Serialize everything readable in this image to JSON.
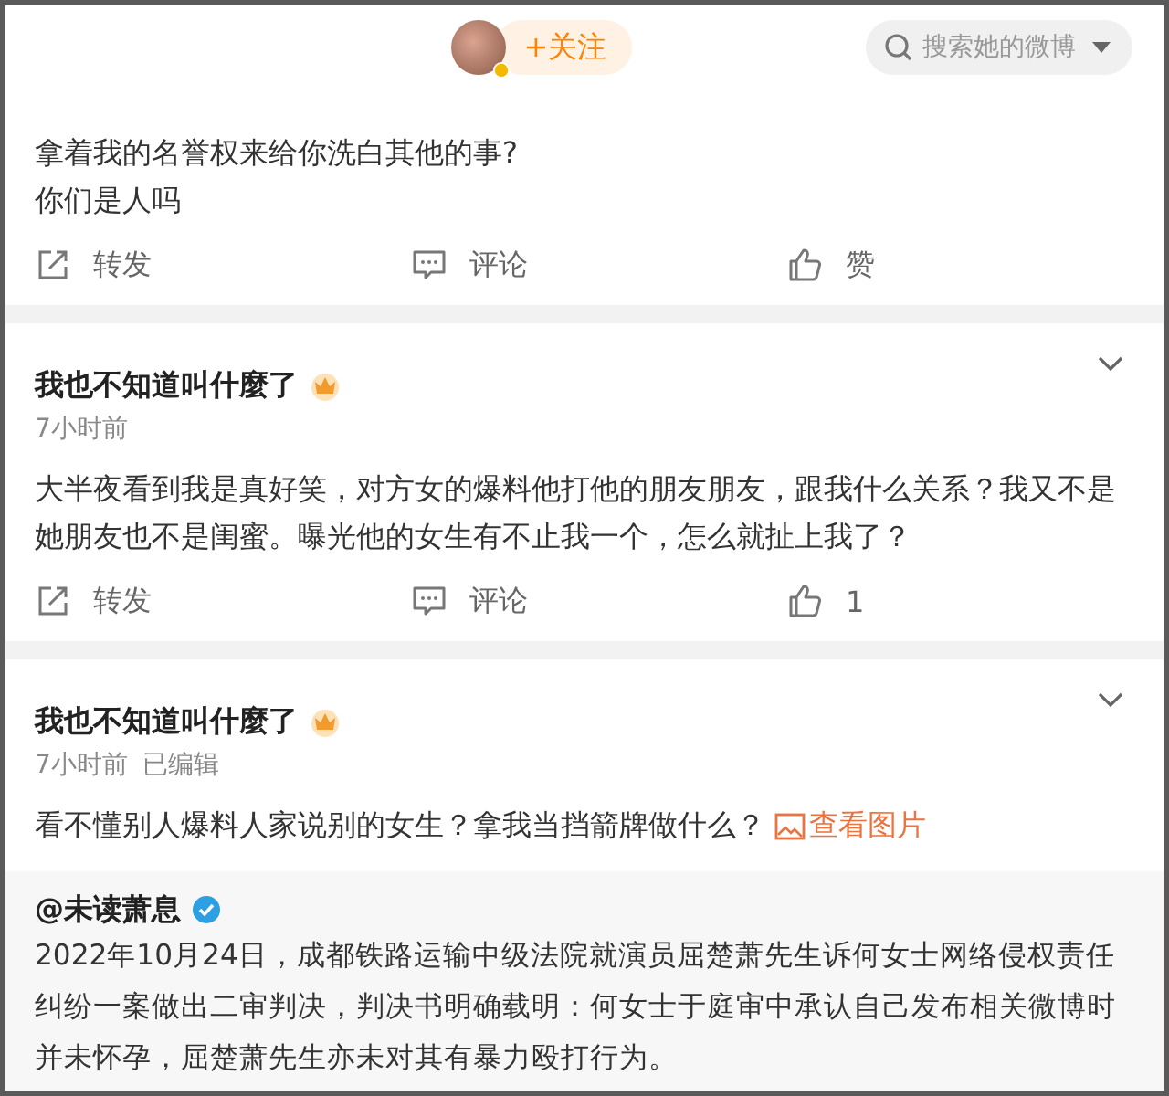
{
  "header": {
    "follow_button": "+关注",
    "search": {
      "placeholder": "搜索她的微博"
    }
  },
  "posts": [
    {
      "lines": [
        "拿着我的名誉权来给你洗白其他的事?",
        "你们是人吗"
      ],
      "actions": [
        {
          "kind": "repost",
          "label": "转发"
        },
        {
          "kind": "comment",
          "label": "评论"
        },
        {
          "kind": "like",
          "label": "赞"
        }
      ]
    },
    {
      "author": "我也不知道叫什麼了",
      "time": "7小时前",
      "lines": [
        "大半夜看到我是真好笑，对方女的爆料他打他的朋友朋友，跟我什么关系？我又不是她朋友也不是闺蜜。曝光他的女生有不止我一个，怎么就扯上我了？"
      ],
      "actions": [
        {
          "kind": "repost",
          "label": "转发"
        },
        {
          "kind": "comment",
          "label": "评论"
        },
        {
          "kind": "like",
          "label": "1"
        }
      ]
    },
    {
      "author": "我也不知道叫什麼了",
      "time": "7小时前",
      "edited": "已编辑",
      "lines": [
        "看不懂别人爆料人家说别的女生？拿我当挡箭牌做什么？"
      ],
      "link": "查看图片",
      "repost": {
        "author": "@未读萧息",
        "text": "2022年10月24日，成都铁路运输中级法院就演员屈楚萧先生诉何女士网络侵权责任纠纷一案做出二审判决，判决书明确载明：何女士于庭审中承认自己发布相关微博时并未怀孕，屈楚萧先生亦未对其有暴力殴打行为。"
      }
    }
  ]
}
